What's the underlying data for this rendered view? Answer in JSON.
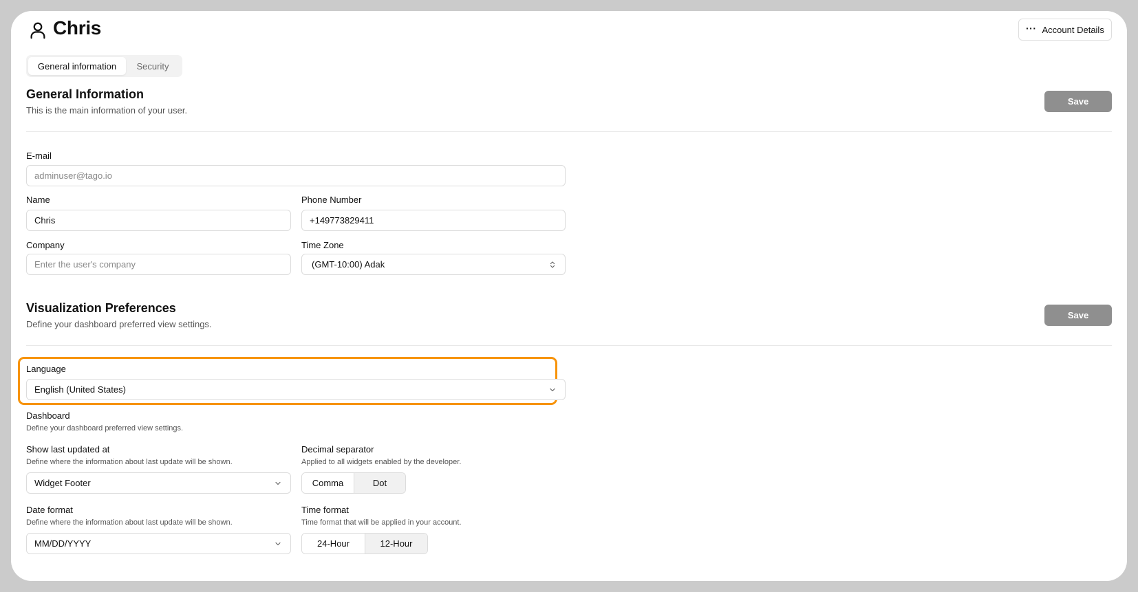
{
  "header": {
    "title": "Chris",
    "account_button": "Account Details"
  },
  "tabs": [
    {
      "label": "General information",
      "active": true
    },
    {
      "label": "Security",
      "active": false
    }
  ],
  "general": {
    "title": "General Information",
    "description": "This is the main information of your user.",
    "save_label": "Save",
    "email_label": "E-mail",
    "email_value": "adminuser@tago.io",
    "name_label": "Name",
    "name_value": "Chris",
    "phone_label": "Phone Number",
    "phone_value": "+149773829411",
    "company_label": "Company",
    "company_placeholder": "Enter the user's company",
    "timezone_label": "Time Zone",
    "timezone_value": "(GMT-10:00) Adak"
  },
  "visualization": {
    "title": "Visualization Preferences",
    "description": "Define your dashboard preferred view settings.",
    "save_label": "Save",
    "language_label": "Language",
    "language_value": "English (United States)",
    "dashboard_label": "Dashboard",
    "dashboard_description": "Define your dashboard preferred view settings.",
    "last_updated_label": "Show last updated at",
    "last_updated_description": "Define where the information about last update will be shown.",
    "last_updated_value": "Widget Footer",
    "decimal_label": "Decimal separator",
    "decimal_description": "Applied to all widgets enabled by the developer.",
    "decimal_options": [
      "Comma",
      "Dot"
    ],
    "date_format_label": "Date format",
    "date_format_description": "Define where the information about last update will be shown.",
    "date_format_value": "MM/DD/YYYY",
    "time_format_label": "Time format",
    "time_format_description": "Time format that will be applied in your account.",
    "time_format_options": [
      "24-Hour",
      "12-Hour"
    ]
  },
  "colors": {
    "highlight": "#f7930a",
    "save_button": "#8f8f8f"
  }
}
